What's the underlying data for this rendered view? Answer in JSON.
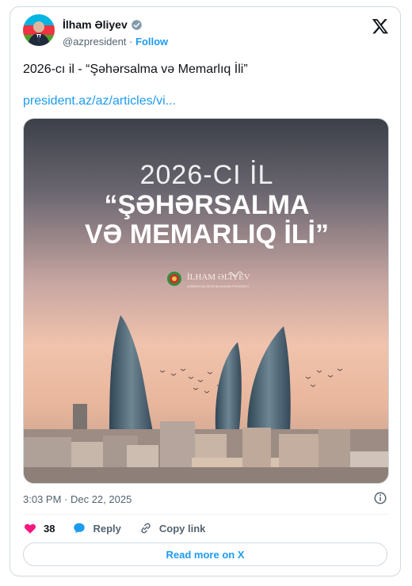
{
  "author": {
    "name": "İlham Əliyev",
    "handle": "@azpresident",
    "separator": "·",
    "follow_label": "Follow"
  },
  "tweet": {
    "text": "2026-cı il - “Şəhərsalma və Memarlıq İli”",
    "link": "president.az/az/articles/vi..."
  },
  "image": {
    "line1": "2026-CI İL",
    "line2": "“ŞƏHƏRSALMA",
    "line3": "VƏ MEMARLIQ İLİ”",
    "logo_name": "İLHAM ƏLİYEV",
    "logo_tag": "AZƏRBAYCAN RESPUBLİKASININ PREZİDENTİ"
  },
  "meta": {
    "time": "3:03 PM · Dec 22, 2025"
  },
  "actions": {
    "likes": "38",
    "reply_label": "Reply",
    "copy_label": "Copy link"
  },
  "read_more_label": "Read more on X",
  "colors": {
    "accent": "#1d9bf0",
    "like": "#f91880",
    "text": "#0f1419",
    "muted": "#536471"
  }
}
